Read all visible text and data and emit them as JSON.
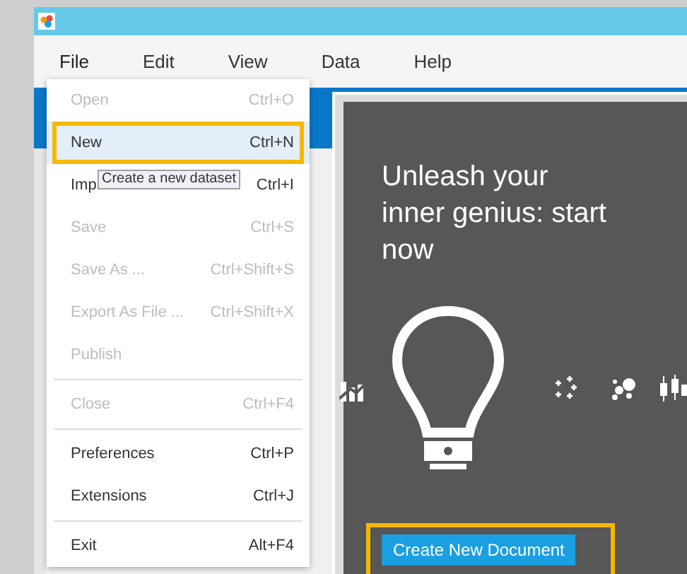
{
  "menu_bar": [
    {
      "label": "File",
      "selected": true
    },
    {
      "label": "Edit",
      "selected": false
    },
    {
      "label": "View",
      "selected": false
    },
    {
      "label": "Data",
      "selected": false
    },
    {
      "label": "Help",
      "selected": false
    }
  ],
  "file_menu": {
    "items": [
      {
        "kind": "item",
        "label": "Open",
        "shortcut": "Ctrl+O",
        "disabled": true,
        "selected": false,
        "outlined": false
      },
      {
        "kind": "item",
        "label": "New",
        "shortcut": "Ctrl+N",
        "disabled": false,
        "selected": true,
        "outlined": true
      },
      {
        "kind": "item",
        "label": "Imp",
        "shortcut": "Ctrl+I",
        "disabled": false,
        "selected": false,
        "outlined": false
      },
      {
        "kind": "item",
        "label": "Save",
        "shortcut": "Ctrl+S",
        "disabled": true,
        "selected": false,
        "outlined": false
      },
      {
        "kind": "item",
        "label": "Save As ...",
        "shortcut": "Ctrl+Shift+S",
        "disabled": true,
        "selected": false,
        "outlined": false
      },
      {
        "kind": "item",
        "label": "Export As File ...",
        "shortcut": "Ctrl+Shift+X",
        "disabled": true,
        "selected": false,
        "outlined": false
      },
      {
        "kind": "item",
        "label": "Publish",
        "disabled": true,
        "selected": false,
        "outlined": false
      },
      {
        "kind": "separator"
      },
      {
        "kind": "item",
        "label": "Close",
        "shortcut": "Ctrl+F4",
        "disabled": true,
        "selected": false,
        "outlined": false
      },
      {
        "kind": "separator"
      },
      {
        "kind": "item",
        "label": "Preferences",
        "shortcut": "Ctrl+P",
        "disabled": false,
        "selected": false,
        "outlined": false
      },
      {
        "kind": "item",
        "label": "Extensions",
        "shortcut": "Ctrl+J",
        "disabled": false,
        "selected": false,
        "outlined": false
      },
      {
        "kind": "separator"
      },
      {
        "kind": "item",
        "label": "Exit",
        "shortcut": "Alt+F4",
        "disabled": false,
        "selected": false,
        "outlined": false
      }
    ]
  },
  "tooltip": "Create a new dataset",
  "welcome": {
    "headline": "Unleash your inner genius: start now",
    "button": {
      "label": "Create New Document",
      "outlined": true
    }
  }
}
